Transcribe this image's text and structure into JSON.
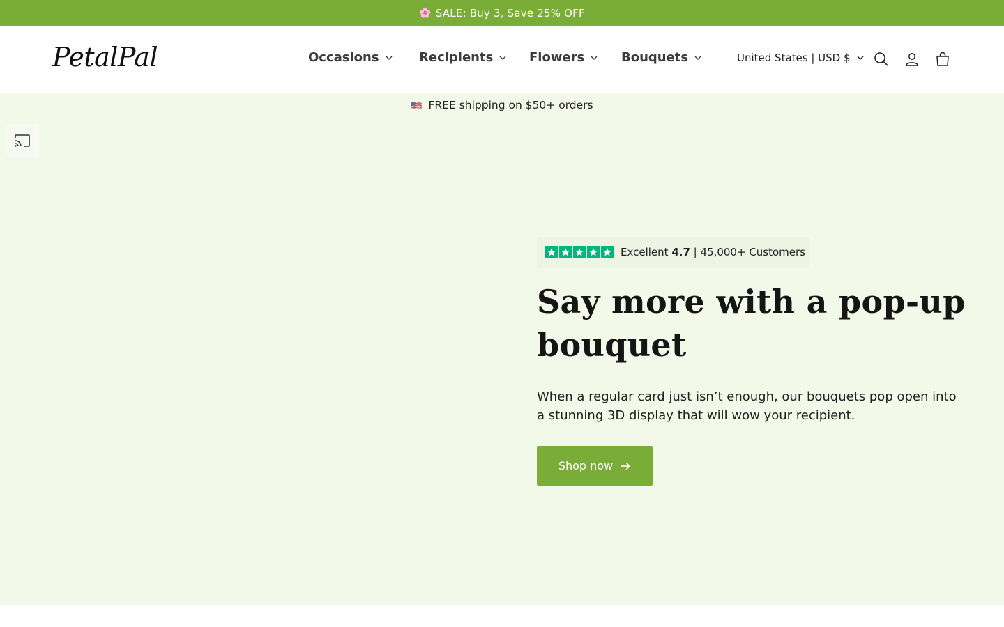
{
  "announcement": {
    "icon": "cherry-blossom-icon",
    "emoji": "🌸",
    "text": "SALE: Buy 3, Save 25% OFF",
    "bg_color": "#7aac38"
  },
  "header": {
    "logo": "PetalPal",
    "nav": [
      {
        "label": "Occasions"
      },
      {
        "label": "Recipients"
      },
      {
        "label": "Flowers"
      },
      {
        "label": "Bouquets"
      }
    ],
    "region": "United States | USD $",
    "icons": [
      "search-icon",
      "account-icon",
      "cart-icon"
    ]
  },
  "hero": {
    "shipping_flag": "🇺🇸",
    "shipping_text": "FREE shipping on $50+ orders",
    "rating": {
      "label": "Excellent",
      "score": "4.7",
      "customers": "| 45,000+ Customers",
      "stars": 5,
      "star_color": "#00b67a"
    },
    "headline": "Say more with a pop-up bouquet",
    "subcopy": "When a regular card just isn’t enough, our bouquets pop open into a stunning 3D display that will wow your recipient.",
    "cta_label": "Shop now",
    "bg_color": "#f3f9e8",
    "accent_color": "#7aac38"
  }
}
